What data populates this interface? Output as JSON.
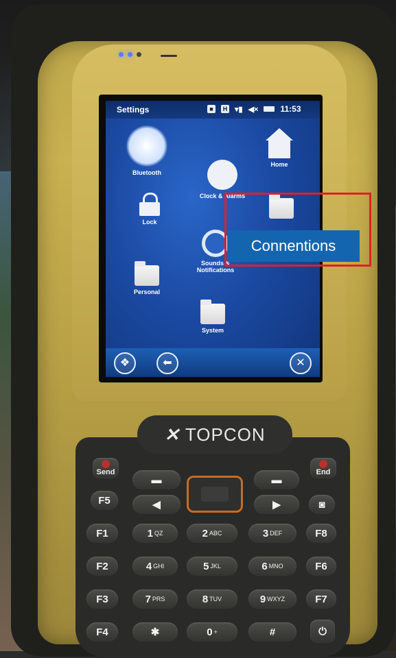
{
  "screen": {
    "title": "Settings",
    "status": {
      "clock": "11:53"
    },
    "tiles": [
      {
        "label": "Bluetooth"
      },
      {
        "label": "Home"
      },
      {
        "label": "Clock & Alarms"
      },
      {
        "label": "Lock"
      },
      {
        "label": "Sounds & Notifications"
      },
      {
        "label": "Personal"
      },
      {
        "label": "System"
      }
    ],
    "taskbar": {
      "start_glyph": "❖",
      "back_glyph": "⬅",
      "close_glyph": "✕"
    }
  },
  "annotation": {
    "label": "Connentions",
    "color": "#e21f26"
  },
  "device": {
    "brand": "TOPCON",
    "keys": {
      "send": "Send",
      "end": "End",
      "f1": "F1",
      "f2": "F2",
      "f3": "F3",
      "f4": "F4",
      "f5": "F5",
      "f6": "F6",
      "f7": "F7",
      "f8": "F8",
      "k1": "1",
      "k1_sub": "QZ",
      "k2": "2",
      "k2_sub": "ABC",
      "k3": "3",
      "k3_sub": "DEF",
      "k4": "4",
      "k4_sub": "GHI",
      "k5": "5",
      "k5_sub": "JKL",
      "k6": "6",
      "k6_sub": "MNO",
      "k7": "7",
      "k7_sub": "PRS",
      "k8": "8",
      "k8_sub": "TUV",
      "k9": "9",
      "k9_sub": "WXYZ",
      "k0": "0",
      "k0_sub": "+",
      "star": "✱",
      "hash": "#",
      "power": "⏻"
    }
  }
}
